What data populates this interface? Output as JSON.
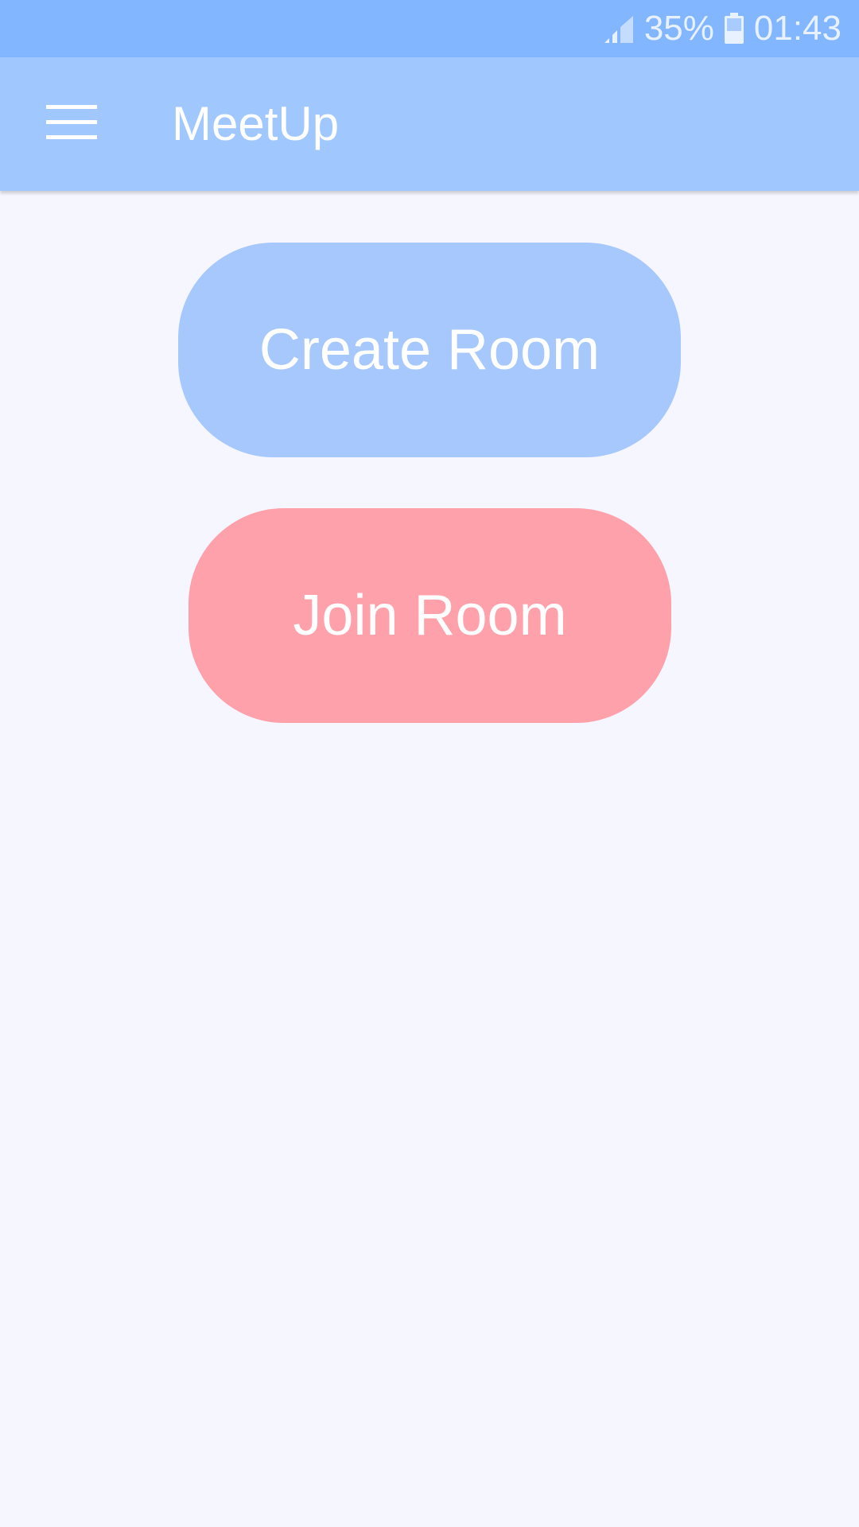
{
  "status_bar": {
    "battery_percent": "35%",
    "time": "01:43",
    "icons": [
      "signal-icon",
      "battery-icon"
    ]
  },
  "app_bar": {
    "title": "MeetUp",
    "menu_icon": "hamburger-menu-icon"
  },
  "main": {
    "create_room_label": "Create Room",
    "join_room_label": "Join Room"
  },
  "colors": {
    "status_bar": "#82b6ff",
    "app_bar": "#a0c8ff",
    "background": "#f5f6ff",
    "create_button": "#a6c8fd",
    "join_button": "#ffa1aa"
  }
}
